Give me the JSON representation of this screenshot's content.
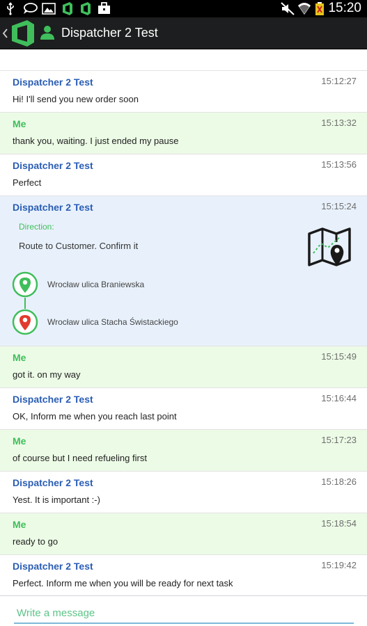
{
  "status_bar": {
    "time": "15:20",
    "icons": [
      "usb-icon",
      "chat-bubble-icon",
      "image-icon",
      "app-notification-icon",
      "app-notification-icon",
      "briefcase-icon",
      "mute-icon",
      "wifi-icon",
      "battery-icon"
    ]
  },
  "header": {
    "title": "Dispatcher 2 Test"
  },
  "colors": {
    "accent_green": "#3fbe5b",
    "sender_blue": "#2a5db5",
    "me_bg": "#ecfbe6",
    "task_bg": "#e8f1fb"
  },
  "messages": [
    {
      "sender": "Dispatcher 2 Test",
      "time": "15:12:27",
      "text": "Hi! I'll send you new order soon"
    },
    {
      "sender": "Me",
      "time": "15:13:32",
      "text": "thank you, waiting.  I just ended my pause"
    },
    {
      "sender": "Dispatcher 2 Test",
      "time": "15:13:56",
      "text": "Perfect"
    },
    {
      "sender": "Dispatcher 2 Test",
      "time": "15:15:24",
      "direction_label": "Direction:",
      "direction_text": "Route to Customer. Confirm it",
      "start_address": "Wrocław ulica Braniewska",
      "end_address": "Wrocław ulica Stacha Świstackiego"
    },
    {
      "sender": "Me",
      "time": "15:15:49",
      "text": "got it. on my way"
    },
    {
      "sender": "Dispatcher 2 Test",
      "time": "15:16:44",
      "text": "OK, Inform me when you reach last point"
    },
    {
      "sender": "Me",
      "time": "15:17:23",
      "text": "of course but I need refueling first"
    },
    {
      "sender": "Dispatcher 2 Test",
      "time": "15:18:26",
      "text": "Yest. It is important :-)"
    },
    {
      "sender": "Me",
      "time": "15:18:54",
      "text": "ready to go"
    },
    {
      "sender": "Dispatcher 2 Test",
      "time": "15:19:42",
      "text": "Perfect. Inform me when you will be ready for next task"
    }
  ],
  "composer": {
    "placeholder": "Write a message",
    "value": ""
  }
}
